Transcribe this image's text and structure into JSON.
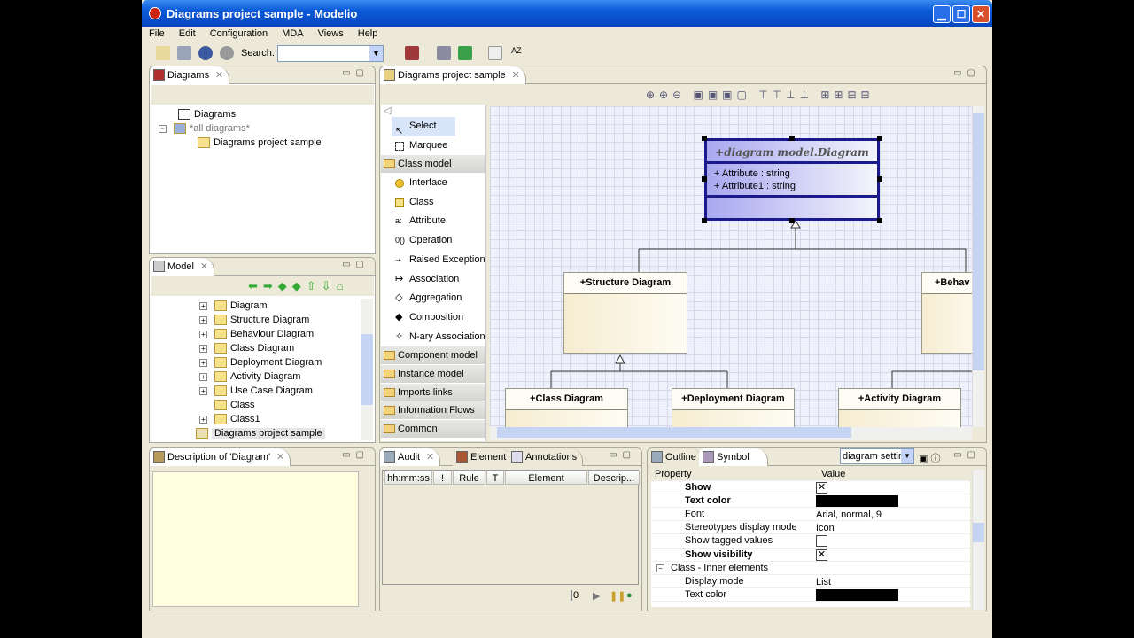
{
  "window": {
    "title": "Diagrams project sample - Modelio",
    "minimize": "▁",
    "maximize": "☐",
    "close": "✕"
  },
  "menu": [
    "File",
    "Edit",
    "Configuration",
    "MDA",
    "Views",
    "Help"
  ],
  "toolbar": {
    "search_label": "Search:",
    "search_value": ""
  },
  "diagrams_panel": {
    "tab": "Diagrams",
    "items": [
      "Diagrams",
      "*all diagrams*",
      "Diagrams project sample"
    ]
  },
  "model_panel": {
    "tab": "Model",
    "items": [
      "Diagram",
      "Structure Diagram",
      "Behaviour Diagram",
      "Class Diagram",
      "Deployment Diagram",
      "Activity Diagram",
      "Use Case Diagram",
      "Class",
      "Class1",
      "Diagrams project sample"
    ]
  },
  "description_panel": {
    "tab": "Description of 'Diagram'"
  },
  "editor": {
    "tab": "Diagrams project sample"
  },
  "palette": {
    "tools": [
      "Select",
      "Marquee"
    ],
    "drawer_open": "Class model",
    "items": [
      "Interface",
      "Class",
      "Attribute",
      "Operation",
      "Raised Exception",
      "Association",
      "Aggregation",
      "Composition",
      "N-ary Association"
    ],
    "drawers": [
      "Component model",
      "Instance model",
      "Imports links",
      "Information Flows",
      "Common"
    ]
  },
  "diagram": {
    "main": {
      "title": "+diagram model.Diagram",
      "attributes": [
        "+ Attribute : string",
        "+ Attribute1 : string"
      ]
    },
    "classes": [
      "+Structure Diagram",
      "+Behav",
      "+Class Diagram",
      "+Deployment Diagram",
      "+Activity Diagram"
    ]
  },
  "audit": {
    "tabs": [
      "Audit",
      "Element",
      "Annotations"
    ],
    "columns": [
      "hh:mm:ss",
      "!",
      "Rule",
      "T",
      "Element",
      "Descrip..."
    ],
    "counter": "0"
  },
  "symbol": {
    "tabs": [
      "Outline",
      "Symbol"
    ],
    "dropdown": "diagram settin",
    "columns": [
      "Property",
      "Value"
    ],
    "rows": [
      {
        "k": "Show",
        "v": "",
        "type": "check",
        "checked": true,
        "bold": true
      },
      {
        "k": "Text color",
        "v": "",
        "type": "color",
        "bold": true
      },
      {
        "k": "Font",
        "v": "Arial, normal, 9"
      },
      {
        "k": "Stereotypes display mode",
        "v": "Icon"
      },
      {
        "k": "Show tagged values",
        "v": "",
        "type": "check",
        "checked": false
      },
      {
        "k": "Show visibility",
        "v": "",
        "type": "check",
        "checked": true,
        "bold": true
      },
      {
        "k": "Class - Inner elements",
        "v": "",
        "group": true
      },
      {
        "k": "Display mode",
        "v": "List"
      },
      {
        "k": "Text color",
        "v": "",
        "type": "color"
      }
    ]
  },
  "colors": {
    "selection": "#1a1a8c",
    "class_fill": "#f6ecd0",
    "titlebar": "#0a5ad8"
  }
}
